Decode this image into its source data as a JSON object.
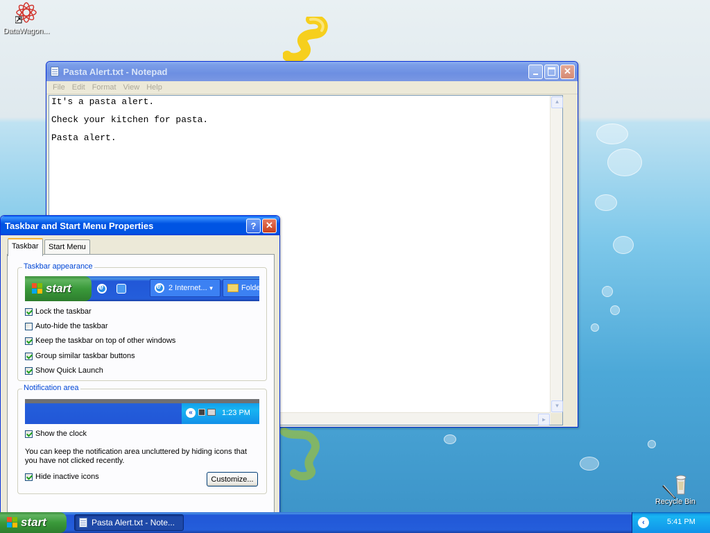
{
  "desktop": {
    "icons": [
      {
        "label": "DataWagon..."
      },
      {
        "label": "Recycle Bin"
      }
    ]
  },
  "notepad": {
    "title": "Pasta Alert.txt - Notepad",
    "menu": [
      "File",
      "Edit",
      "Format",
      "View",
      "Help"
    ],
    "lines": [
      "It's a pasta alert.",
      "Check your kitchen for pasta.",
      "Pasta alert."
    ]
  },
  "dialog": {
    "title": "Taskbar and Start Menu Properties",
    "help_glyph": "?",
    "close_glyph": "✕",
    "tabs": [
      "Taskbar",
      "Start Menu"
    ],
    "appearance": {
      "legend": "Taskbar appearance",
      "preview": {
        "start_label": "start",
        "task1": "2 Internet...",
        "task2": "Folde"
      },
      "options": [
        {
          "label": "Lock the taskbar",
          "checked": true
        },
        {
          "label": "Auto-hide the taskbar",
          "checked": false
        },
        {
          "label": "Keep the taskbar on top of other windows",
          "checked": true
        },
        {
          "label": "Group similar taskbar buttons",
          "checked": true
        },
        {
          "label": "Show Quick Launch",
          "checked": true
        }
      ]
    },
    "notification": {
      "legend": "Notification area",
      "preview_time": "1:23 PM",
      "show_clock": {
        "label": "Show the clock",
        "checked": true
      },
      "description": "You can keep the notification area uncluttered by hiding icons that you have not clicked recently.",
      "hide_inactive": {
        "label": "Hide inactive icons",
        "checked": true
      },
      "customize_label": "Customize..."
    }
  },
  "taskbar": {
    "start_label": "start",
    "active_task": "Pasta Alert.txt - Note...",
    "clock": "5:41 PM"
  }
}
